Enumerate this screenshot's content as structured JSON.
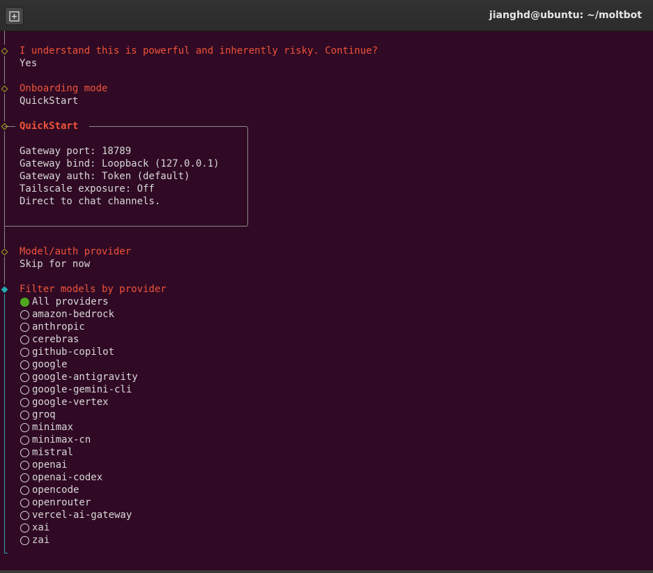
{
  "window": {
    "title": "jianghd@ubuntu: ~/moltbot"
  },
  "steps": {
    "risk": {
      "question": "I understand this is powerful and inherently risky. Continue?",
      "answer": "Yes"
    },
    "onboarding": {
      "question": "Onboarding mode",
      "answer": "QuickStart"
    },
    "quickstart": {
      "title": "QuickStart",
      "lines": [
        "Gateway port: 18789",
        "Gateway bind: Loopback (127.0.0.1)",
        "Gateway auth: Token (default)",
        "Tailscale exposure: Off",
        "Direct to chat channels."
      ]
    },
    "model_auth": {
      "question": "Model/auth provider",
      "answer": "Skip for now"
    },
    "filter": {
      "question": "Filter models by provider",
      "selected": "All providers",
      "options": [
        "All providers",
        "amazon-bedrock",
        "anthropic",
        "cerebras",
        "github-copilot",
        "google",
        "google-antigravity",
        "google-gemini-cli",
        "google-vertex",
        "groq",
        "minimax",
        "minimax-cn",
        "mistral",
        "openai",
        "openai-codex",
        "opencode",
        "openrouter",
        "vercel-ai-gateway",
        "xai",
        "zai"
      ]
    }
  },
  "colors": {
    "background": "#300a24",
    "prompt": "#f0533a",
    "done_marker": "#a3a824",
    "active_marker": "#24a9b5",
    "radio_selected": "#4ea81e"
  }
}
